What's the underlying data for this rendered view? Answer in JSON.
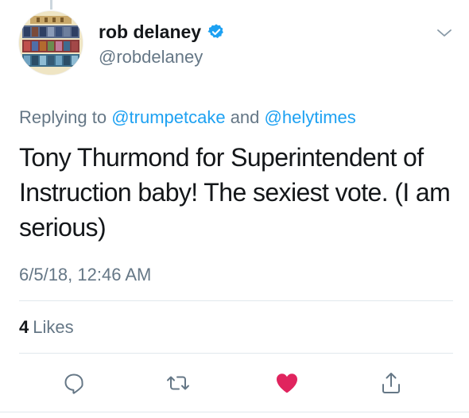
{
  "author": {
    "display_name": "rob delaney",
    "handle": "@robdelaney",
    "verified": true
  },
  "reply": {
    "prefix": "Replying to ",
    "user1": "@trumpetcake",
    "joiner": " and ",
    "user2": "@helytimes"
  },
  "tweet": {
    "text": "Tony Thurmond for Superintendent of Instruction baby! The sexiest vote. (I am serious)",
    "timestamp": "6/5/18, 12:46 AM"
  },
  "stats": {
    "likes_count": "4",
    "likes_label": "Likes"
  },
  "actions": [
    {
      "name": "reply",
      "icon": "speech-bubble-icon"
    },
    {
      "name": "retweet",
      "icon": "retweet-icon"
    },
    {
      "name": "like",
      "icon": "heart-icon",
      "active": true
    },
    {
      "name": "share",
      "icon": "share-icon"
    }
  ],
  "colors": {
    "link": "#1da1f2",
    "secondary_text": "#657786",
    "like_active": "#e0245e",
    "divider": "#e1e8ed"
  }
}
